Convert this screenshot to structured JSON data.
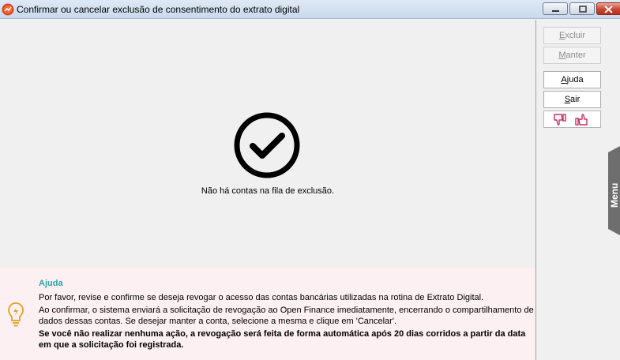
{
  "window": {
    "title": "Confirmar ou cancelar exclusão de consentimento do extrato digital"
  },
  "main": {
    "status_icon": "check-circle-icon",
    "empty_message": "Não há contas na fila de exclusão."
  },
  "side": {
    "excluir_pre": "",
    "excluir_key": "E",
    "excluir_post": "xcluir",
    "manter_pre": "",
    "manter_key": "M",
    "manter_post": "anter",
    "ajuda_pre": "",
    "ajuda_key": "A",
    "ajuda_post": "juda",
    "sair_pre": "",
    "sair_key": "S",
    "sair_post": "air",
    "menu_label": "Menu"
  },
  "help": {
    "title": "Ajuda",
    "line1": "Por favor, revise e confirme se deseja revogar o acesso das contas bancárias utilizadas na rotina de Extrato Digital.",
    "line2": "Ao confirmar, o sistema enviará a solicitação de revogação ao Open Finance imediatamente, encerrando o compartilhamento de",
    "line3": "dados dessas contas. Se desejar manter a conta, selecione a mesma e clique em 'Cancelar'.",
    "bold": "Se você não realizar nenhuma ação, a revogação será feita de forma automática após 20 dias corridos a partir da data em que a solicitação foi registrada."
  },
  "colors": {
    "help_title": "#2aa3a6",
    "help_bg": "#fdf0f3",
    "feedback_icon": "#c0306a",
    "menu_tab": "#6e6e6e"
  }
}
